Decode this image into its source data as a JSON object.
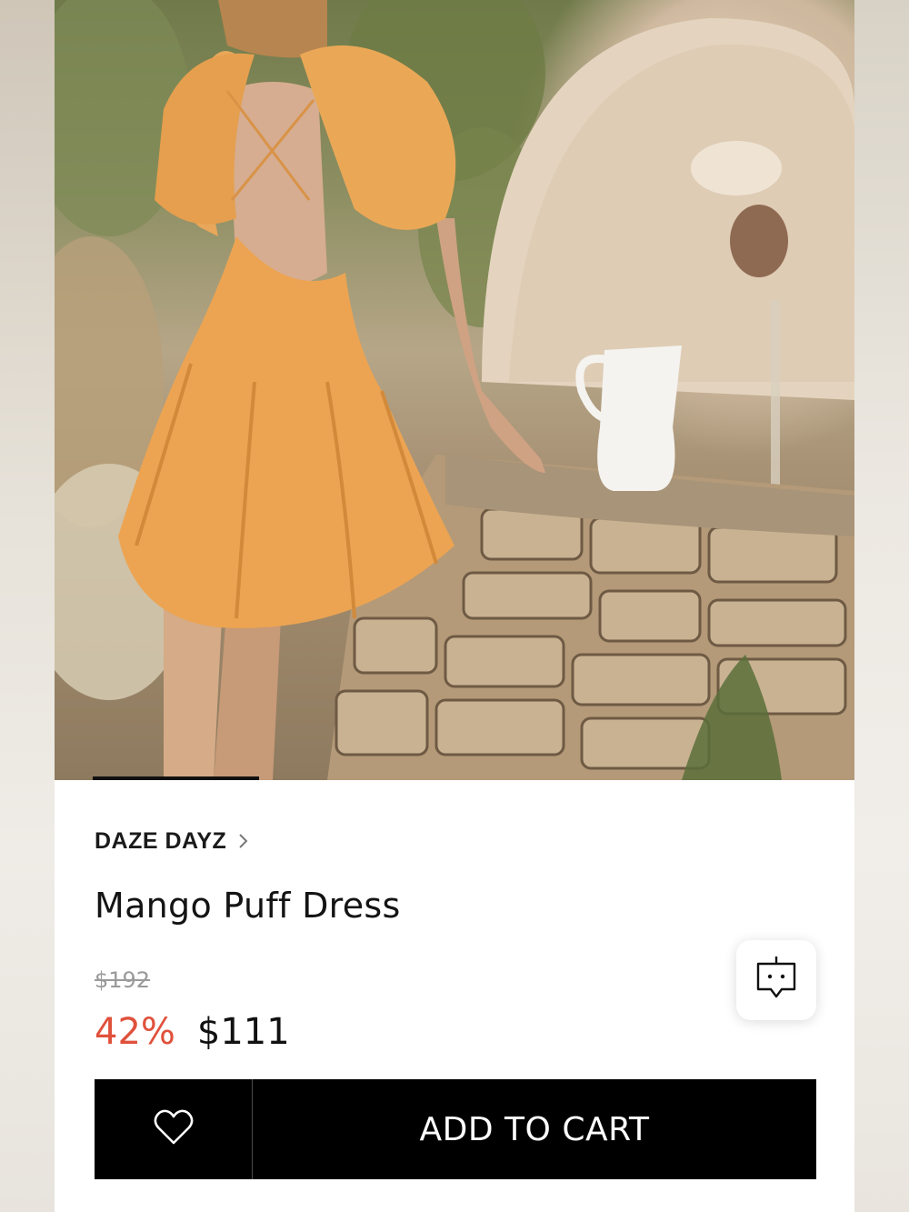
{
  "product": {
    "brand": "DAZE DAYZ",
    "title": "Mango Puff Dress",
    "original_price": "$192",
    "discount": "42%",
    "price": "$111"
  },
  "gallery": {
    "image_description_icon": "product-photo",
    "progress_fraction": 0.23
  },
  "actions": {
    "add_to_cart_label": "ADD TO CART",
    "wishlist_icon": "heart-outline-icon",
    "chat_icon": "chat-bubble-icon"
  },
  "colors": {
    "discount": "#e0513c",
    "cart_bar": "#000000",
    "text": "#141414",
    "strike_price": "#9a9a9a"
  }
}
